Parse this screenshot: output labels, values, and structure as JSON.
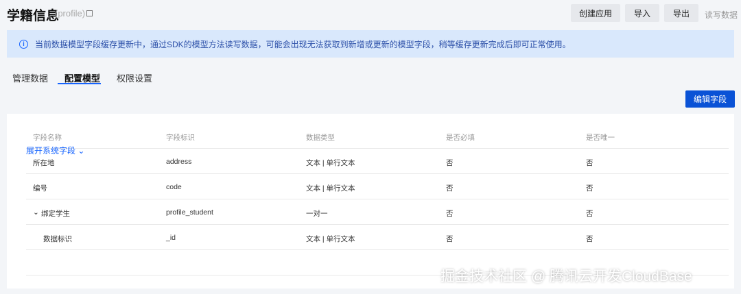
{
  "header": {
    "title": "学籍信息",
    "subtitle": "(profile)",
    "buttons": [
      "创建应用",
      "导入",
      "导出"
    ],
    "read_write": "读写数据"
  },
  "alert": {
    "text": "当前数据模型字段缓存更新中，通过SDK的模型方法读写数据，可能会出现无法获取到新增或更新的模型字段，稍等缓存更新完成后即可正常使用。"
  },
  "tabs": [
    "管理数据",
    "配置模型",
    "权限设置"
  ],
  "edit_button": "编辑字段",
  "table": {
    "headers": [
      "字段名称",
      "字段标识",
      "数据类型",
      "是否必填",
      "是否唯一"
    ],
    "rows": [
      [
        "所在地",
        "address",
        "文本 | 单行文本",
        "否",
        "否"
      ],
      [
        "编号",
        "code",
        "文本 | 单行文本",
        "否",
        "否"
      ],
      [
        "绑定学生",
        "profile_student",
        "一对一",
        "否",
        "否"
      ],
      [
        "数据标识",
        "_id",
        "文本 | 单行文本",
        "否",
        "否"
      ]
    ]
  },
  "expand_link": "展开系统字段",
  "watermark": "掘金技术社区 @ 腾讯云开发CloudBase"
}
